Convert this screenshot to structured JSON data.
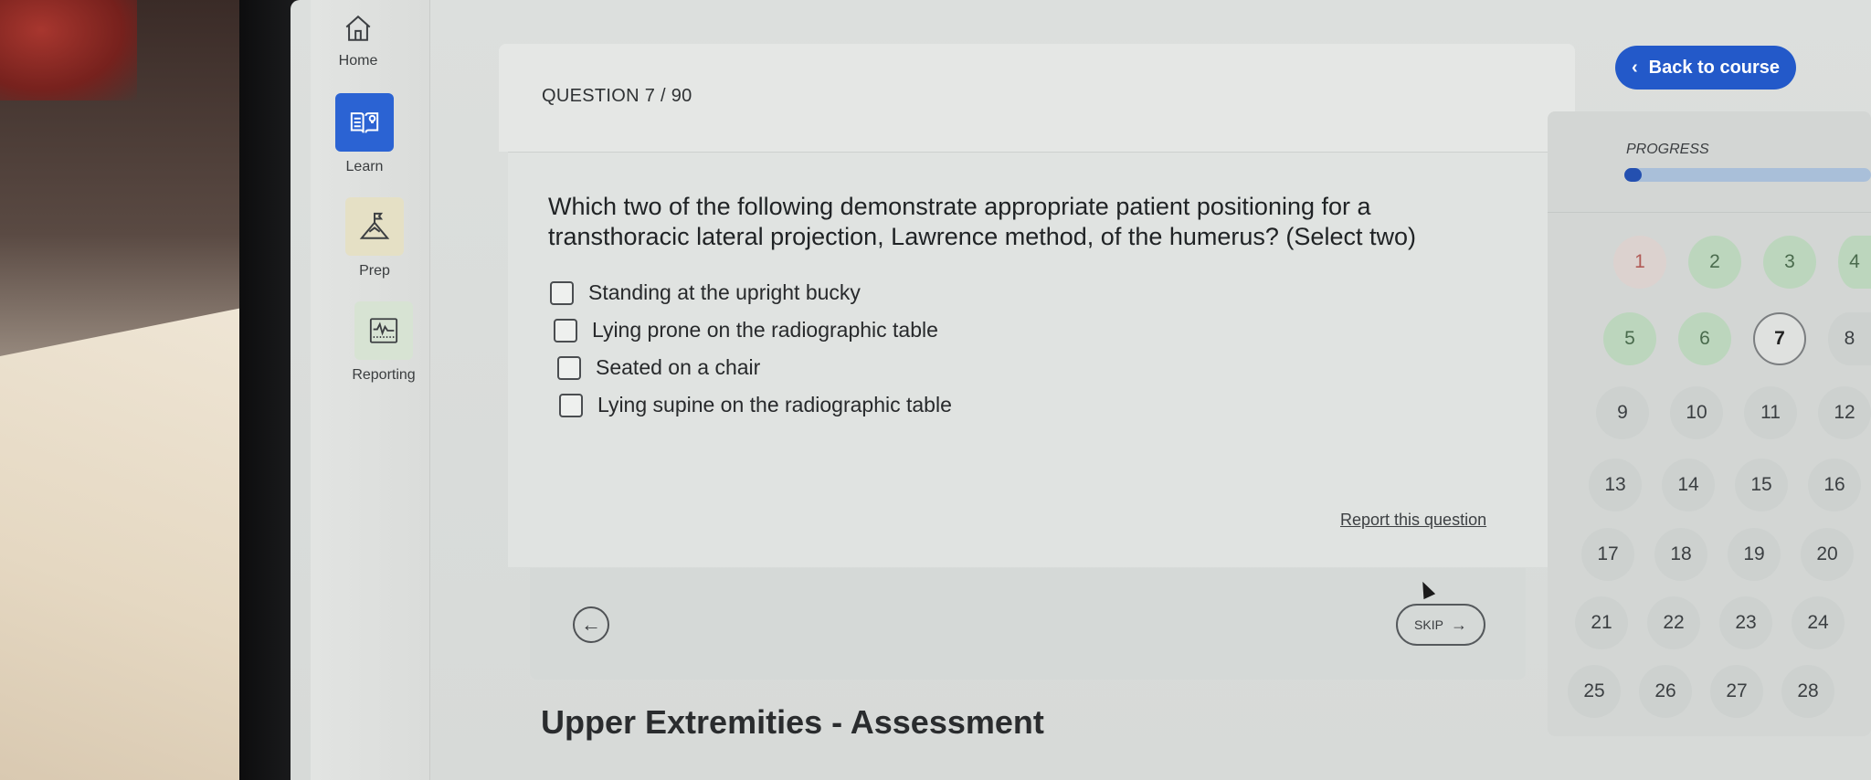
{
  "nav": {
    "items": [
      {
        "label": "Home",
        "icon": "house-icon"
      },
      {
        "label": "Learn",
        "icon": "book-bulb-icon"
      },
      {
        "label": "Prep",
        "icon": "mountain-flag-icon"
      },
      {
        "label": "Reporting",
        "icon": "heartbeat-chart-icon"
      }
    ]
  },
  "question": {
    "counter": "QUESTION 7 / 90",
    "text": "Which two of the following demonstrate appropriate patient positioning for a transthoracic lateral projection, Lawrence method, of the humerus? (Select two)",
    "options": [
      "Standing at the upright bucky",
      "Lying prone on the radiographic table",
      "Seated on a chair",
      "Lying supine on the radiographic table"
    ],
    "report_link": "Report this question",
    "skip_label": "SKIP"
  },
  "course_title": "Upper Extremities - Assessment",
  "sidebar": {
    "back_label": "Back to course",
    "progress_label": "PROGRESS",
    "progress_fraction": 0.02,
    "questions": [
      {
        "n": "1",
        "state": "wrong"
      },
      {
        "n": "2",
        "state": "right"
      },
      {
        "n": "3",
        "state": "right"
      },
      {
        "n": "4",
        "state": "right"
      },
      {
        "n": "5",
        "state": "right"
      },
      {
        "n": "6",
        "state": "right"
      },
      {
        "n": "7",
        "state": "current"
      },
      {
        "n": "8",
        "state": "unanswered"
      },
      {
        "n": "9",
        "state": "unanswered"
      },
      {
        "n": "10",
        "state": "unanswered"
      },
      {
        "n": "11",
        "state": "unanswered"
      },
      {
        "n": "12",
        "state": "unanswered"
      },
      {
        "n": "13",
        "state": "unanswered"
      },
      {
        "n": "14",
        "state": "unanswered"
      },
      {
        "n": "15",
        "state": "unanswered"
      },
      {
        "n": "16",
        "state": "unanswered"
      },
      {
        "n": "17",
        "state": "unanswered"
      },
      {
        "n": "18",
        "state": "unanswered"
      },
      {
        "n": "19",
        "state": "unanswered"
      },
      {
        "n": "20",
        "state": "unanswered"
      },
      {
        "n": "21",
        "state": "unanswered"
      },
      {
        "n": "22",
        "state": "unanswered"
      },
      {
        "n": "23",
        "state": "unanswered"
      },
      {
        "n": "24",
        "state": "unanswered"
      },
      {
        "n": "25",
        "state": "unanswered"
      },
      {
        "n": "26",
        "state": "unanswered"
      },
      {
        "n": "27",
        "state": "unanswered"
      },
      {
        "n": "28",
        "state": "unanswered"
      }
    ]
  },
  "colors": {
    "accent": "#2359c9",
    "learn_active": "#2b63d3",
    "answered_right": "#bcd6bd",
    "answered_wrong": "#dcd2cf"
  }
}
